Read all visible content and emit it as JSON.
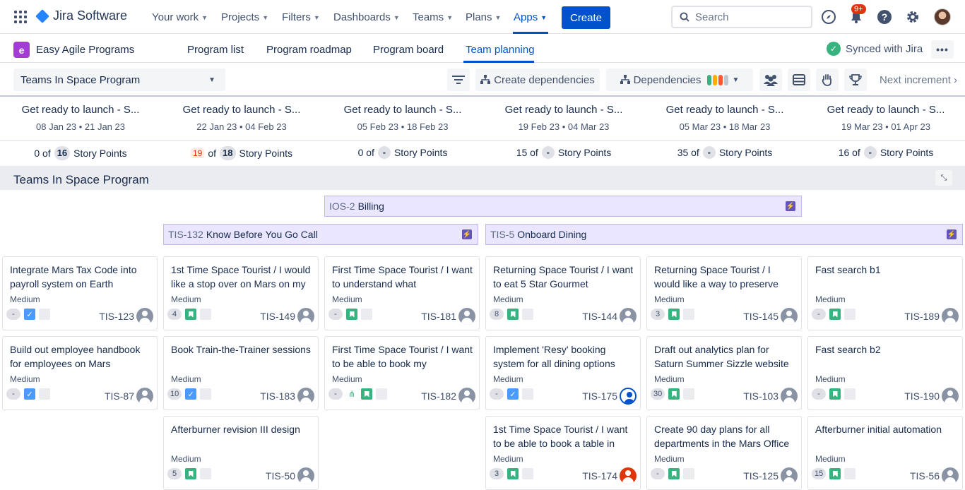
{
  "topnav": {
    "product": "Jira Software",
    "items": [
      "Your work",
      "Projects",
      "Filters",
      "Dashboards",
      "Teams",
      "Plans",
      "Apps"
    ],
    "active": "Apps",
    "create_label": "Create",
    "search_placeholder": "Search",
    "notif_badge": "9+",
    "icons": [
      "app-switcher-icon",
      "compass-icon",
      "notification-icon",
      "help-icon",
      "settings-icon"
    ]
  },
  "subnav": {
    "app_name": "Easy Agile Programs",
    "tabs": [
      "Program list",
      "Program roadmap",
      "Program board",
      "Team planning"
    ],
    "active_tab": "Team planning",
    "sync_status": "Synced with Jira",
    "more": "•••"
  },
  "toolbar": {
    "program": "Teams In Space Program",
    "create_deps": "Create dependencies",
    "deps": "Dependencies",
    "dep_colors": [
      "#36b37e",
      "#ffab00",
      "#ff5630",
      "#c1c7d0"
    ],
    "next": "Next increment"
  },
  "sprints": [
    {
      "title": "Get ready to launch - S...",
      "dates": "08 Jan 23 • 21 Jan 23",
      "done": "0 of",
      "total": "16",
      "unit": "Story Points",
      "over": ""
    },
    {
      "title": "Get ready to launch - S...",
      "dates": "22 Jan 23 • 04 Feb 23",
      "done": "of",
      "total": "18",
      "unit": "Story Points",
      "over": "19"
    },
    {
      "title": "Get ready to launch - S...",
      "dates": "05 Feb 23 • 18 Feb 23",
      "done": "0 of",
      "total": "-",
      "unit": "Story Points",
      "over": ""
    },
    {
      "title": "Get ready to launch - S...",
      "dates": "19 Feb 23 • 04 Mar 23",
      "done": "15 of",
      "total": "-",
      "unit": "Story Points",
      "over": ""
    },
    {
      "title": "Get ready to launch - S...",
      "dates": "05 Mar 23 • 18 Mar 23",
      "done": "35 of",
      "total": "-",
      "unit": "Story Points",
      "over": ""
    },
    {
      "title": "Get ready to launch - S...",
      "dates": "19 Mar 23 • 01 Apr 23",
      "done": "16 of",
      "total": "-",
      "unit": "Story Points",
      "over": ""
    }
  ],
  "group": {
    "title": "Teams In Space Program"
  },
  "epics": [
    {
      "key": "IOS-2",
      "name": "Billing"
    },
    {
      "key": "TIS-132",
      "name": "Know Before You Go Call"
    },
    {
      "key": "TIS-5",
      "name": "Onboard Dining"
    }
  ],
  "cards": [
    {
      "title": "Integrate Mars Tax Code into payroll system on Earth",
      "priority": "Medium",
      "est": "-",
      "type": "task",
      "key": "TIS-123",
      "avatar": "grey"
    },
    {
      "title": "1st Time Space Tourist / I would like a stop over on Mars on my",
      "priority": "Medium",
      "est": "4",
      "type": "story",
      "key": "TIS-149",
      "avatar": "grey"
    },
    {
      "title": "First Time Space Tourist / I want to understand what",
      "priority": "Medium",
      "est": "-",
      "type": "story",
      "key": "TIS-181",
      "avatar": "grey"
    },
    {
      "title": "Returning Space Tourist / I want to eat 5 Star Gourmet",
      "priority": "Medium",
      "est": "8",
      "type": "story",
      "key": "TIS-144",
      "avatar": "grey"
    },
    {
      "title": "Returning Space Tourist / I would like a way to preserve",
      "priority": "Medium",
      "est": "3",
      "type": "story",
      "key": "TIS-145",
      "avatar": "grey"
    },
    {
      "title": "Fast search b1",
      "priority": "Medium",
      "est": "-",
      "type": "story",
      "key": "TIS-189",
      "avatar": "grey"
    },
    {
      "title": "Build out employee handbook for employees on Mars",
      "priority": "Medium",
      "est": "-",
      "type": "task",
      "key": "TIS-87",
      "avatar": "grey"
    },
    {
      "title": "Book Train-the-Trainer sessions",
      "priority": "Medium",
      "est": "10",
      "type": "task",
      "key": "TIS-183",
      "avatar": "grey"
    },
    {
      "title": "First Time Space Tourist / I want to be able to book my",
      "priority": "Medium",
      "est": "-",
      "type": "story-dep",
      "key": "TIS-182",
      "avatar": "grey"
    },
    {
      "title": "Implement 'Resy' booking system for all dining options",
      "priority": "Medium",
      "est": "-",
      "type": "task",
      "key": "TIS-175",
      "avatar": "blue"
    },
    {
      "title": "Draft out analytics plan for Saturn Summer Sizzle website",
      "priority": "Medium",
      "est": "30",
      "type": "story",
      "key": "TIS-103",
      "avatar": "grey"
    },
    {
      "title": "Fast search b2",
      "priority": "Medium",
      "est": "-",
      "type": "story",
      "key": "TIS-190",
      "avatar": "grey"
    },
    {
      "title": "Afterburner revision III design",
      "priority": "Medium",
      "est": "5",
      "type": "story",
      "key": "TIS-50",
      "avatar": "grey"
    },
    {
      "title": "1st Time Space Tourist / I want to be able to book a table in",
      "priority": "Medium",
      "est": "3",
      "type": "story",
      "key": "TIS-174",
      "avatar": "red"
    },
    {
      "title": "Create 90 day plans for all departments in the Mars Office",
      "priority": "Medium",
      "est": "-",
      "type": "story",
      "key": "TIS-125",
      "avatar": "grey"
    },
    {
      "title": "Afterburner initial automation",
      "priority": "Medium",
      "est": "15",
      "type": "story",
      "key": "TIS-56",
      "avatar": "grey"
    }
  ]
}
